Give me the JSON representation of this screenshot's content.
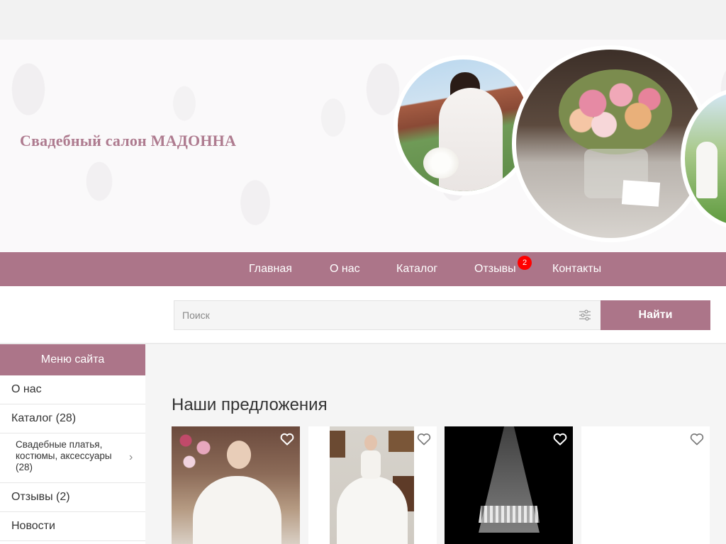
{
  "header": {
    "site_title": "Свадебный салон МАДОННА"
  },
  "nav": {
    "items": [
      "Главная",
      "О нас",
      "Каталог",
      "Отзывы",
      "Контакты"
    ],
    "reviews_badge": "2"
  },
  "search": {
    "placeholder": "Поиск",
    "button_label": "Найти"
  },
  "sidebar": {
    "title": "Меню сайта",
    "items": [
      "О нас",
      "Каталог (28)",
      "Свадебные платья, костюмы, аксессуары (28)",
      "Отзывы (2)",
      "Новости"
    ]
  },
  "main": {
    "section_title": "Наши предложения"
  },
  "colors": {
    "accent": "#ac7589",
    "title_color": "#ae7b8f",
    "badge": "#ff0000"
  }
}
